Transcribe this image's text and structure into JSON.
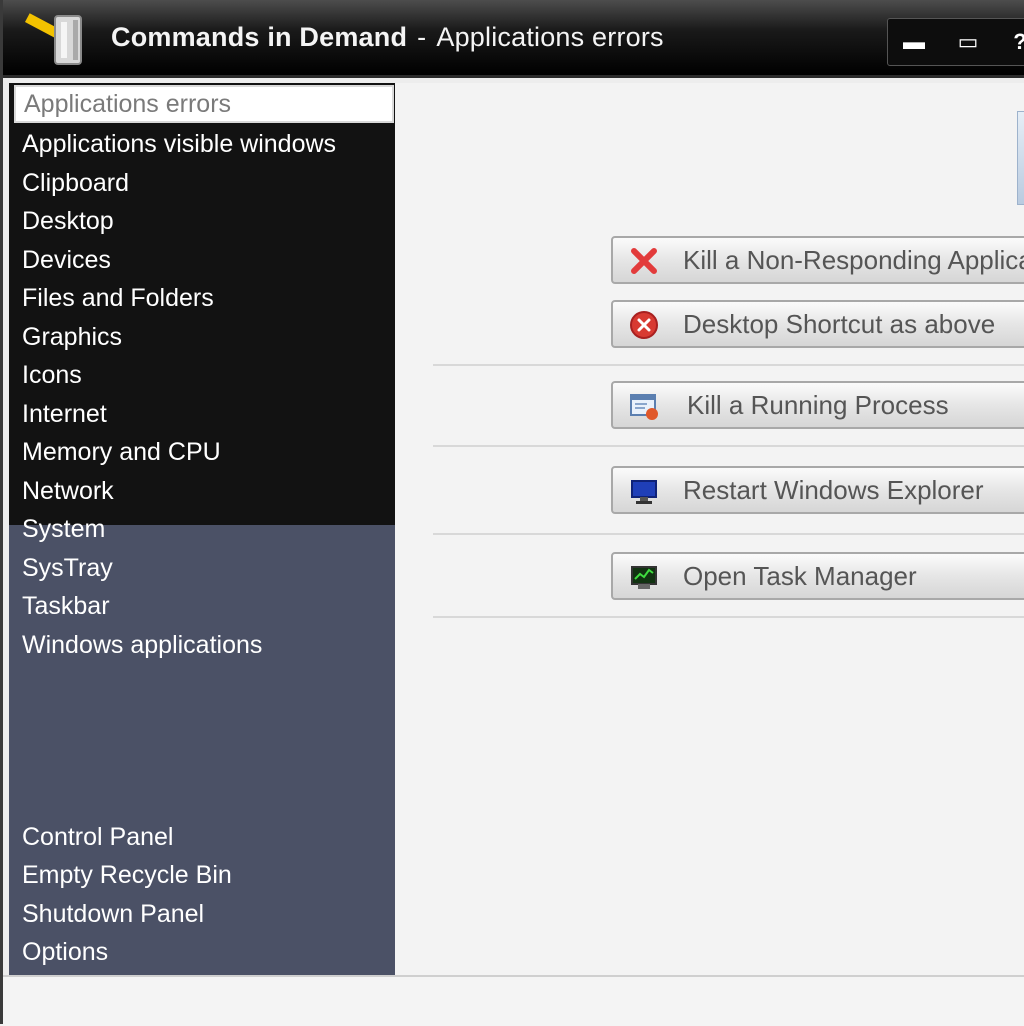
{
  "window": {
    "app_title": "Commands in Demand",
    "separator": "-",
    "section_title": "Applications errors",
    "controls": {
      "minimize": "▬",
      "maximize": "▭",
      "help": "?"
    }
  },
  "sidebar": {
    "categories": [
      "Applications errors",
      "Applications visible windows",
      "Clipboard",
      "Desktop",
      "Devices",
      "Files and Folders",
      "Graphics",
      "Icons",
      "Internet",
      "Memory and CPU",
      "Network",
      "System",
      "SysTray",
      "Taskbar",
      "Windows applications"
    ],
    "tools": [
      "Control Panel",
      "Empty Recycle Bin",
      "Shutdown Panel",
      "Options"
    ]
  },
  "actions": [
    {
      "label": "Kill a Non-Responding Application",
      "icon": "red-x-icon"
    },
    {
      "label": "Desktop Shortcut as above",
      "icon": "error-circle-icon"
    },
    {
      "label": "Kill a Running Process",
      "icon": "process-window-icon"
    },
    {
      "label": "Restart Windows Explorer",
      "icon": "explorer-monitor-icon"
    },
    {
      "label": "Open Task Manager",
      "icon": "task-manager-icon"
    }
  ],
  "colors": {
    "title_bg": "#000000",
    "sidebar_bg": "#4b5166",
    "category_bg": "#121212",
    "content_bg": "#f3f3f3"
  }
}
